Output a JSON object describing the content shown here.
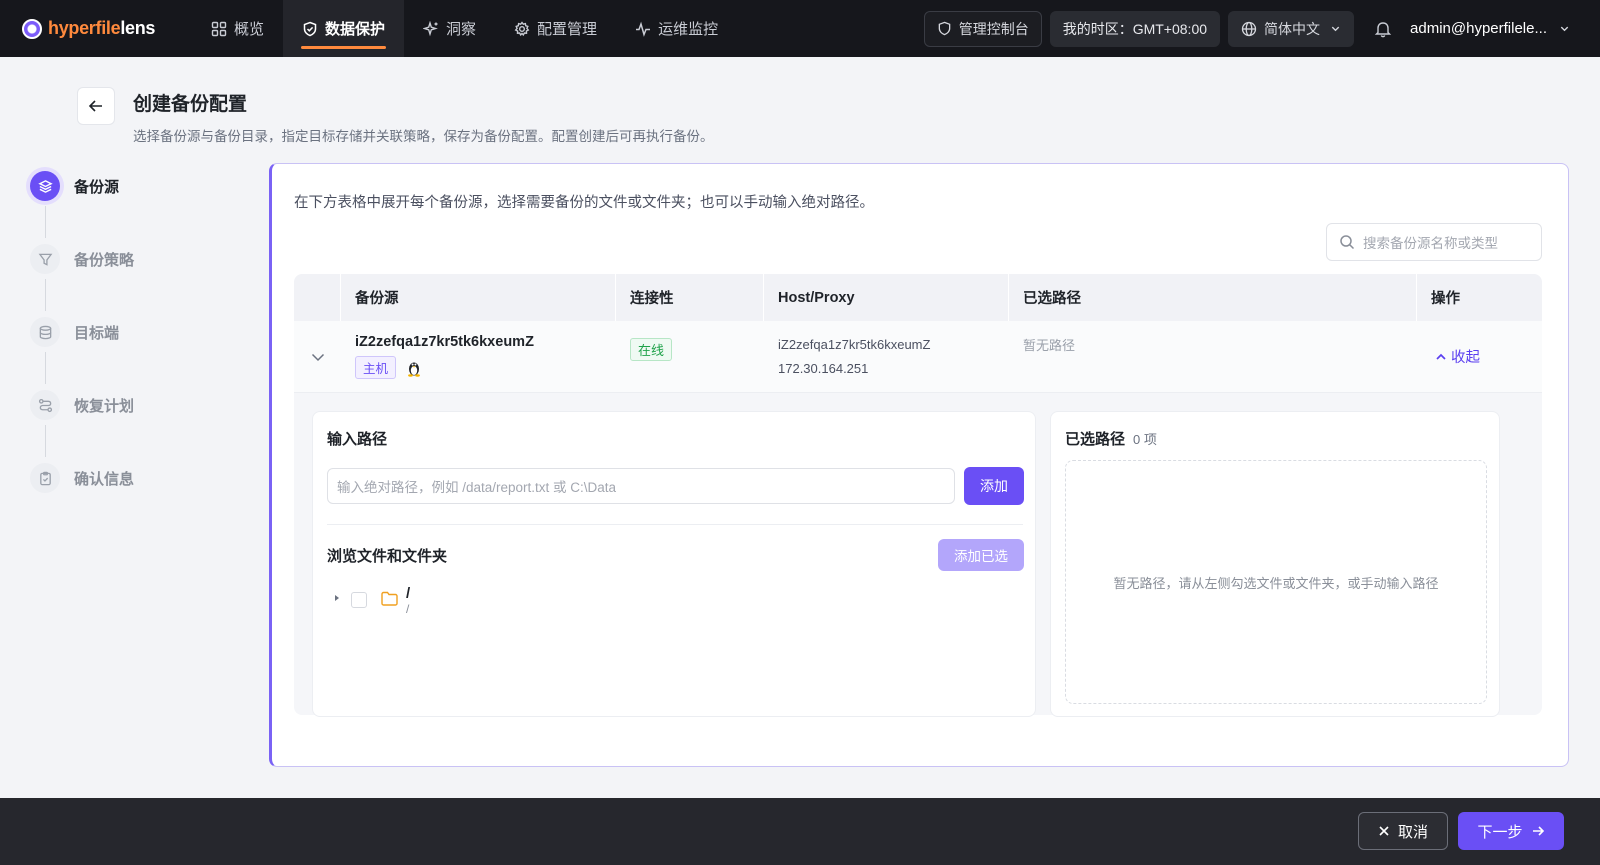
{
  "app": {
    "logo_a": "hyperfile",
    "logo_b": "lens"
  },
  "nav": [
    {
      "label": "概览",
      "icon": "dashboard-icon"
    },
    {
      "label": "数据保护",
      "icon": "shield-icon",
      "active": true
    },
    {
      "label": "洞察",
      "icon": "sparkle-icon"
    },
    {
      "label": "配置管理",
      "icon": "gear-icon"
    },
    {
      "label": "运维监控",
      "icon": "pulse-icon"
    }
  ],
  "topbar": {
    "console": "管理控制台",
    "timezone_label": "我的时区：",
    "timezone_value": "GMT+08:00",
    "language": "简体中文",
    "user": "admin@hyperfilele..."
  },
  "header": {
    "title": "创建备份配置",
    "description": "选择备份源与备份目录，指定目标存储并关联策略，保存为备份配置。配置创建后可再执行备份。"
  },
  "steps": [
    {
      "label": "备份源",
      "active": true
    },
    {
      "label": "备份策略"
    },
    {
      "label": "目标端"
    },
    {
      "label": "恢复计划"
    },
    {
      "label": "确认信息"
    }
  ],
  "main": {
    "hint": "在下方表格中展开每个备份源，选择需要备份的文件或文件夹；也可以手动输入绝对路径。",
    "search_placeholder": "搜索备份源名称或类型",
    "columns": [
      "备份源",
      "连接性",
      "Host/Proxy",
      "已选路径",
      "操作"
    ],
    "row": {
      "name": "iZ2zefqa1z7kr5tk6kxeumZ",
      "type_tag": "主机",
      "status": "在线",
      "host": "iZ2zefqa1z7kr5tk6kxeumZ",
      "ip": "172.30.164.251",
      "paths": "暂无路径",
      "action": "收起"
    },
    "input_panel": {
      "title": "输入路径",
      "placeholder": "输入绝对路径，例如 /data/report.txt 或 C:\\Data",
      "add_button": "添加",
      "browse_title": "浏览文件和文件夹",
      "add_selected_button": "添加已选",
      "tree_root_name": "/",
      "tree_root_path": "/"
    },
    "selected_panel": {
      "title": "已选路径",
      "count": "0 项",
      "empty_text": "暂无路径，请从左侧勾选文件或文件夹，或手动输入路径"
    }
  },
  "footer": {
    "cancel": "取消",
    "next": "下一步"
  },
  "colors": {
    "accent": "#6a4ff5",
    "brand_orange": "#ff8a3d",
    "online_green": "#1fa24a"
  }
}
